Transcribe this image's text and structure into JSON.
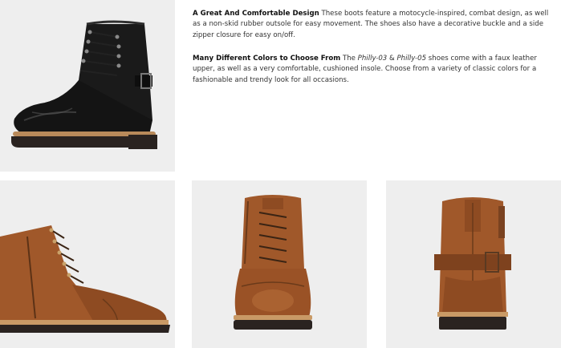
{
  "features": [
    {
      "heading": "A Great And Comfortable Design",
      "body": " These boots feature a motocycle-inspired, combat design, as well as a non-skid rubber outsole for easy movement. The shoes also have a decorative buckle and a side zipper closure for easy on/off."
    },
    {
      "heading": "Many Different Colors to Choose From",
      "intro": " The ",
      "model_1": "Philly-03",
      "joiner": " & ",
      "model_2": "Philly-05",
      "body": " shoes come with a faux leather upper, as well as a very comfortable, cushioned insole. Choose from a variety of classic colors for a fashionable and trendy look for all occasions."
    }
  ],
  "images": {
    "hero": "black-boot-side-view",
    "side": "brown-boot-side-view",
    "front": "brown-boot-front-view",
    "back": "brown-boot-back-view"
  },
  "colors": {
    "panel_bg": "#eeeeee",
    "black_leather": "#1a1a1a",
    "brown_leather": "#a0582a",
    "sole": "#2a2320",
    "welt": "#b98a5a"
  }
}
